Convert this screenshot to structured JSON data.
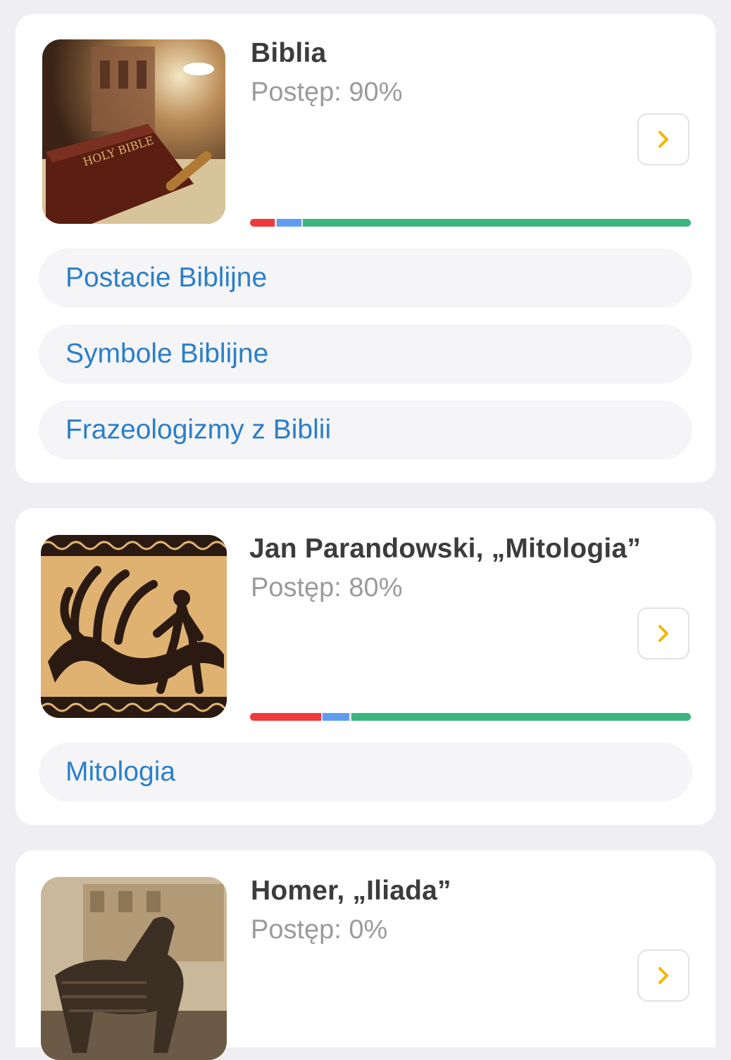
{
  "colors": {
    "red": "#ee3a3a",
    "blue": "#5f9df2",
    "green": "#3cb67f",
    "link": "#2b7fc9",
    "arrow": "#f2b705"
  },
  "cards": [
    {
      "title": "Biblia",
      "progress_label": "Postęp: 90%",
      "image_icon": "bible-image",
      "progress_segments": [
        {
          "color": "red",
          "fraction": 0.06
        },
        {
          "color": "blue",
          "fraction": 0.06
        },
        {
          "color": "green",
          "fraction": 0.88
        }
      ],
      "topics": [
        "Postacie Biblijne",
        "Symbole Biblijne",
        "Frazeologizmy z Biblii"
      ]
    },
    {
      "title": "Jan Parandowski, „Mitologia”",
      "progress_label": "Postęp: 80%",
      "image_icon": "hydra-image",
      "progress_segments": [
        {
          "color": "red",
          "fraction": 0.165
        },
        {
          "color": "blue",
          "fraction": 0.065
        },
        {
          "color": "green",
          "fraction": 0.77
        }
      ],
      "topics": [
        "Mitologia"
      ]
    },
    {
      "title": "Homer, „Iliada”",
      "progress_label": "Postęp: 0%",
      "image_icon": "trojan-horse-image",
      "progress_segments": [],
      "topics": []
    }
  ]
}
